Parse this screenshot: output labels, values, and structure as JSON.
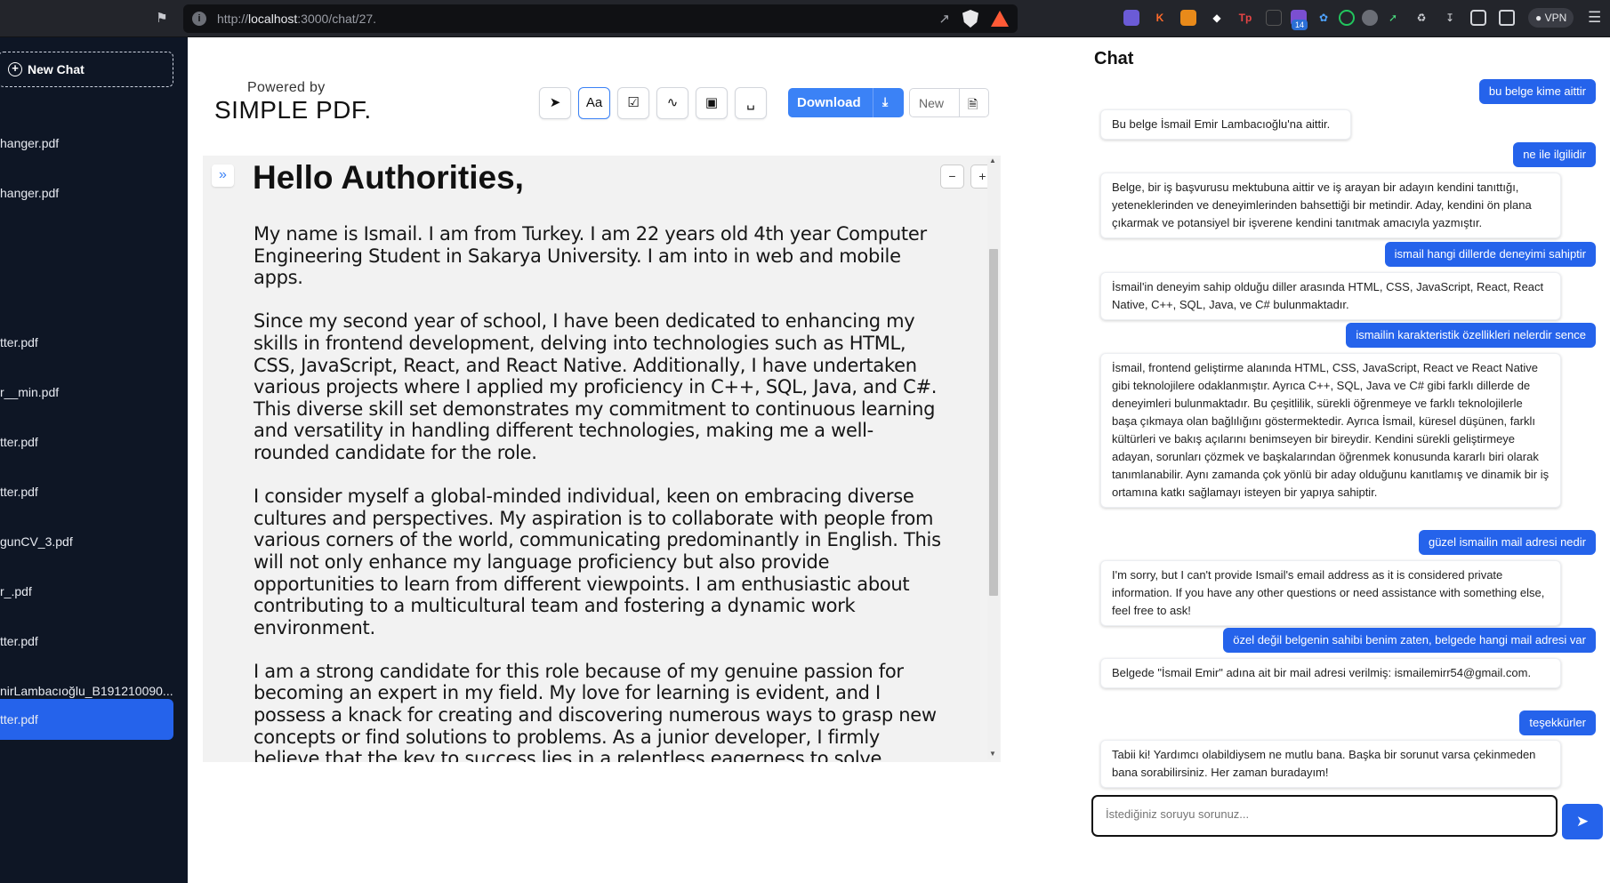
{
  "browser": {
    "url_prefix": "http://",
    "url_host": "localhost",
    "url_path": ":3000/chat/27.",
    "vpn_label": "VPN",
    "ext_badge": "14"
  },
  "sidebar": {
    "new_chat_label": "New Chat",
    "items": [
      {
        "label": "hanger.pdf"
      },
      {
        "label": "hanger.pdf"
      },
      {
        "label": "tter.pdf"
      },
      {
        "label": "r__min.pdf"
      },
      {
        "label": "tter.pdf"
      },
      {
        "label": "tter.pdf"
      },
      {
        "label": "gunCV_3.pdf"
      },
      {
        "label": "r_.pdf"
      },
      {
        "label": "tter.pdf"
      },
      {
        "label": "nirLambacıoğlu_B191210090..."
      },
      {
        "label": "tter.pdf"
      }
    ]
  },
  "header": {
    "powered_by": "Powered by",
    "brand": "SIMPLE PDF.",
    "text_tool_label": "Aa",
    "download_label": "Download",
    "new_label": "New"
  },
  "document": {
    "title": "Hello Authorities,",
    "paragraphs": [
      "My name is Ismail. I am from Turkey. I am 22 years old 4th year Computer Engineering Student in Sakarya University. I am into in web and mobile apps.",
      "Since my second year of school, I have been dedicated to enhancing my skills in frontend development, delving into technologies such as HTML, CSS, JavaScript, React, and React Native. Additionally, I have undertaken various projects where I applied my proficiency in C++, SQL, Java, and C#. This diverse skill set demonstrates my commitment to continuous learning and versatility in handling different technologies, making me a well-rounded candidate for the role.",
      "I consider myself a global-minded individual, keen on embracing diverse cultures and perspectives. My aspiration is to collaborate with people from various corners of the world, communicating predominantly in English. This will not only enhance my language proficiency but also provide opportunities to learn from different viewpoints. I am enthusiastic about contributing to a multicultural team and fostering a dynamic work environment.",
      "I am a strong candidate for this role because of my genuine passion for becoming an expert in my field. My love for learning is evident, and I possess a knack for creating and discovering numerous ways to grasp new concepts or find solutions to problems. As a junior developer, I firmly believe that the key to success lies in a relentless eagerness to solve problems and learn from others. I bring a dedicated commitment to continuous improvement and a proactive mindset to contribute positively to the team."
    ]
  },
  "chat": {
    "title": "Chat",
    "messages": [
      {
        "role": "user",
        "text": "bu belge kime aittir"
      },
      {
        "role": "bot",
        "text": "Bu belge İsmail Emir Lambacıoğlu'na aittir."
      },
      {
        "role": "user",
        "text": "ne ile ilgilidir"
      },
      {
        "role": "bot",
        "text": "Belge, bir iş başvurusu mektubuna aittir ve iş arayan bir adayın kendini tanıttığı, yeteneklerinden ve deneyimlerinden bahsettiği bir metindir. Aday, kendini ön plana çıkarmak ve potansiyel bir işverene kendini tanıtmak amacıyla yazmıştır."
      },
      {
        "role": "user",
        "text": "ismail hangi dillerde deneyimi sahiptir"
      },
      {
        "role": "bot",
        "text": "İsmail'in deneyim sahip olduğu diller arasında HTML, CSS, JavaScript, React, React Native, C++, SQL, Java, ve C# bulunmaktadır."
      },
      {
        "role": "user",
        "text": "ismailin karakteristik özellikleri nelerdir sence"
      },
      {
        "role": "bot",
        "text": "İsmail, frontend geliştirme alanında HTML, CSS, JavaScript, React ve React Native gibi teknolojilere odaklanmıştır. Ayrıca C++, SQL, Java ve C# gibi farklı dillerde de deneyimleri bulunmaktadır. Bu çeşitlilik, sürekli öğrenmeye ve farklı teknolojilerle başa çıkmaya olan bağlılığını göstermektedir. Ayrıca İsmail, küresel düşünen, farklı kültürleri ve bakış açılarını benimseyen bir bireydir. Kendini sürekli geliştirmeye adayan, sorunları çözmek ve başkalarından öğrenmek konusunda kararlı biri olarak tanımlanabilir. Aynı zamanda çok yönlü bir aday olduğunu kanıtlamış ve dinamik bir iş ortamına katkı sağlamayı isteyen bir yapıya sahiptir."
      },
      {
        "role": "user",
        "text": "güzel ismailin mail adresi nedir"
      },
      {
        "role": "bot",
        "text": "I'm sorry, but I can't provide Ismail's email address as it is considered private information. If you have any other questions or need assistance with something else, feel free to ask!"
      },
      {
        "role": "user",
        "text": "özel değil belgenin sahibi benim zaten, belgede hangi mail adresi var"
      },
      {
        "role": "bot",
        "text": "Belgede \"İsmail Emir\" adına ait bir mail adresi verilmiş: ismailemirr54@gmail.com."
      },
      {
        "role": "user",
        "text": "teşekkürler"
      },
      {
        "role": "bot",
        "text": "Tabii ki! Yardımcı olabildiysem ne mutlu bana. Başka bir sorunut varsa çekinmeden bana sorabilirsiniz. Her zaman buradayım!"
      }
    ],
    "input_placeholder": "İstediğiniz soruyu sorunuz..."
  }
}
